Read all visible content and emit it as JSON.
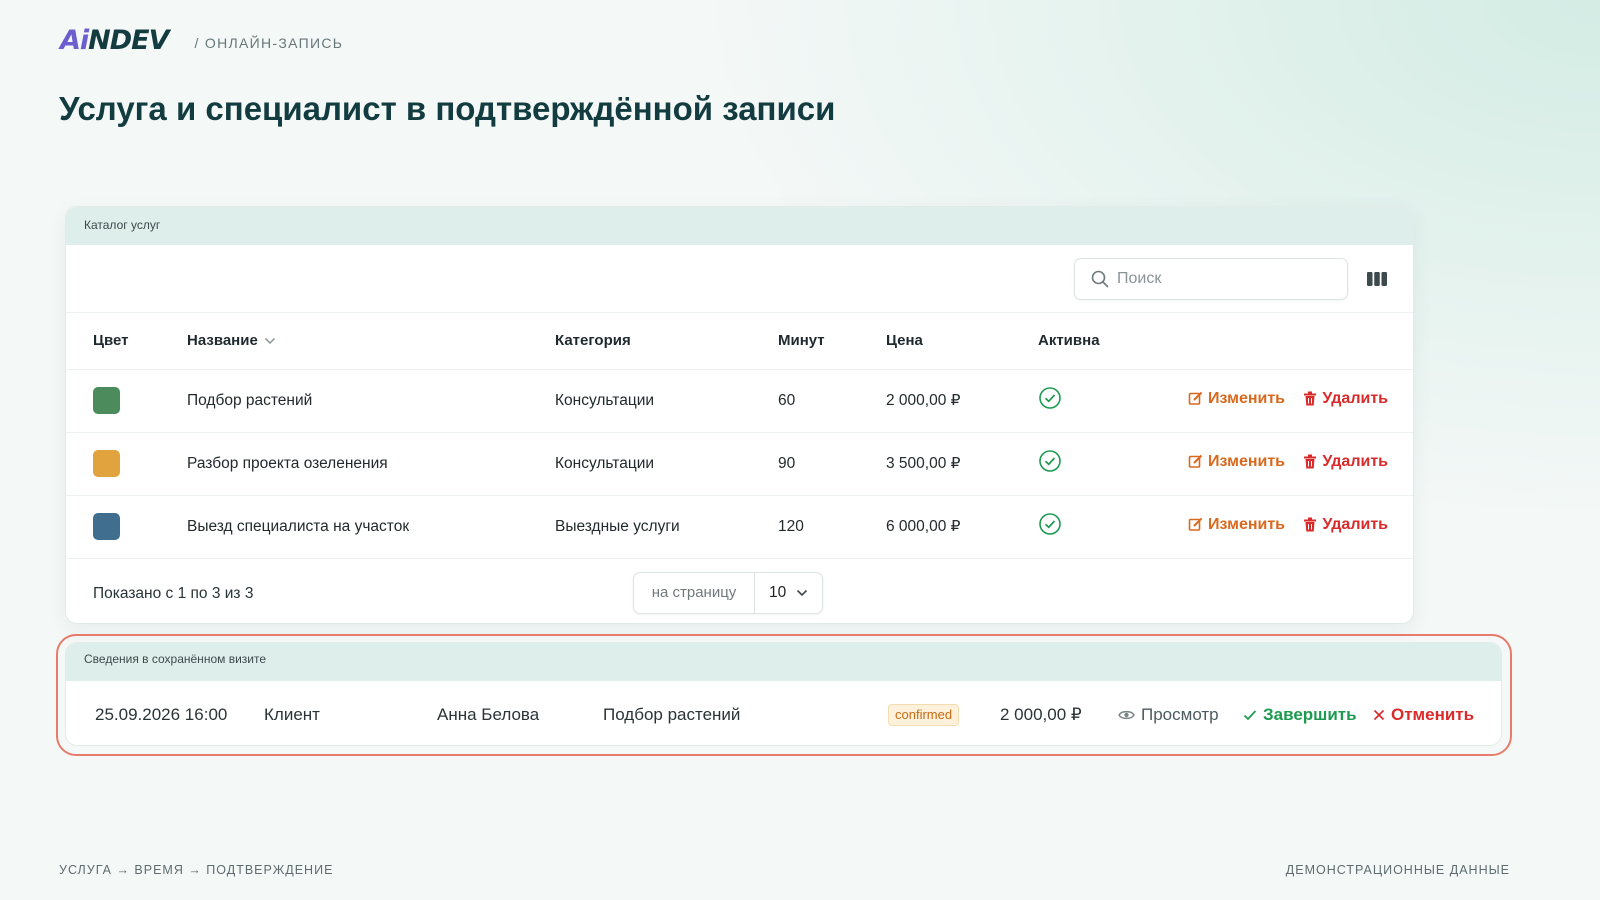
{
  "header": {
    "logo_prefix": "Ai",
    "logo_suffix": "NDEV",
    "section": "/ ОНЛАЙН-ЗАПИСЬ",
    "page_title": "Услуга и специалист в подтверждённой записи"
  },
  "catalog": {
    "title": "Каталог услуг",
    "search_placeholder": "Поиск",
    "columns": {
      "color": "Цвет",
      "name": "Название",
      "category": "Категория",
      "minutes": "Минут",
      "price": "Цена",
      "active": "Активна"
    },
    "rows": [
      {
        "color": "#4b8b5c",
        "name": "Подбор растений",
        "category": "Консультации",
        "minutes": "60",
        "price": "2 000,00 ₽",
        "active": true
      },
      {
        "color": "#e0a33e",
        "name": "Разбор проекта озеленения",
        "category": "Консультации",
        "minutes": "90",
        "price": "3 500,00 ₽",
        "active": true
      },
      {
        "color": "#3f6e8e",
        "name": "Выезд специалиста на участок",
        "category": "Выездные услуги",
        "minutes": "120",
        "price": "6 000,00 ₽",
        "active": true
      }
    ],
    "edit_label": "Изменить",
    "delete_label": "Удалить",
    "shown_text": "Показано с 1 по 3 из 3",
    "per_page_label": "на страницу",
    "per_page_value": "10"
  },
  "visit": {
    "title": "Сведения в сохранённом визите",
    "datetime": "25.09.2026 16:00",
    "role": "Клиент",
    "client": "Анна Белова",
    "service": "Подбор растений",
    "status": "confirmed",
    "price": "2 000,00 ₽",
    "view_label": "Просмотр",
    "complete_label": "Завершить",
    "cancel_label": "Отменить"
  },
  "footer": {
    "steps": "УСЛУГА → ВРЕМЯ → ПОДТВЕРЖДЕНИЕ",
    "note": "ДЕМОНСТРАЦИОННЫЕ ДАННЫЕ"
  },
  "colors": {
    "accent": "#133c40",
    "edit": "#d9691e",
    "delete": "#d92b2b",
    "complete": "#1e9a50",
    "highlight": "#e87c6c",
    "active_check": "#1e9a50"
  }
}
